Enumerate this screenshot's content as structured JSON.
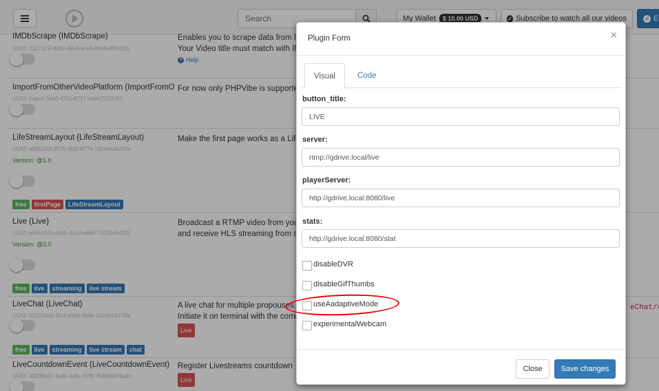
{
  "navbar": {
    "search_placeholder": "Search",
    "wallet_label": "My Wallet",
    "wallet_balance": "$ 10.00 USD",
    "subscribe_label": "Subscribe to watch all our videos",
    "right_button_label": "E"
  },
  "plugins": [
    {
      "title": "IMDbScrape (IMDbScrape)",
      "uuid": "UUID: 2117115f-dc62-49e3-ace9-86c6e8f9c815",
      "description_lines": [
        "Enables you to scrape data from IMD",
        "Your Video title must match with IMD"
      ],
      "help_label": "Help"
    },
    {
      "title": "ImportFromOtherVideoPlatform (ImportFromOtherVideoPlatform)",
      "uuid": "UUID: import-3440-472c-8717-video7332c82",
      "description_lines": [
        "For now only PHPVibe is supported"
      ]
    },
    {
      "title": "LifeStreamLayout (LifeStreamLayout)",
      "uuid": "UUID: a06522bf-3570-4b1f-877a-1d0e5cab205d",
      "version": "Version: @1.0",
      "description_lines": [
        "Make the first page works as a LifeS"
      ],
      "tags": [
        {
          "label": "free",
          "color": "#5cb85c"
        },
        {
          "label": "firstPage",
          "color": "#d9534f"
        },
        {
          "label": "LifeStreamLayout",
          "color": "#337ab7"
        }
      ]
    },
    {
      "title": "Live (Live)",
      "uuid": "UUID: e06b161c-cbd0-4c1d-a484-71018efa2f35",
      "version": "Version: @3.0",
      "description_lines": [
        "Broadcast a RTMP video from your",
        "and receive HLS streaming from se"
      ],
      "tags": [
        {
          "label": "free",
          "color": "#5cb85c"
        },
        {
          "label": "live",
          "color": "#337ab7"
        },
        {
          "label": "streaming",
          "color": "#337ab7"
        },
        {
          "label": "live stream",
          "color": "#337ab7"
        }
      ]
    },
    {
      "title": "LiveChat (LiveChat)",
      "uuid": "UUID: 52222da2-3f14-49db-958e-15ccb1407f0e",
      "description_lines": [
        "A live chat for multiple propouses",
        "Initiate it on terminal with the comma"
      ],
      "badge": "Live",
      "code_snippet": "eChat/cha",
      "tags": [
        {
          "label": "free",
          "color": "#5cb85c"
        },
        {
          "label": "live",
          "color": "#337ab7"
        },
        {
          "label": "streaming",
          "color": "#337ab7"
        },
        {
          "label": "live stream",
          "color": "#337ab7"
        },
        {
          "label": "chat",
          "color": "#337ab7"
        }
      ]
    },
    {
      "title": "LiveCountdownEvent (LiveCountdownEvent)",
      "uuid": "UUID: 43328e37-4adb-4cbc-8cf9-75d6ddd7babc",
      "description_lines": [
        "Register Livestreams countdown"
      ],
      "badge": "Live"
    }
  ],
  "modal": {
    "title": "Plugin Form",
    "close_symbol": "×",
    "tabs": [
      {
        "label": "Visual",
        "active": true
      },
      {
        "label": "Code",
        "active": false
      }
    ],
    "fields": [
      {
        "label": "button_title:",
        "value": "LIVE"
      },
      {
        "label": "server:",
        "value": "rtmp://gdrive.local/live"
      },
      {
        "label": "playerServer:",
        "value": "http://gdrive.local:8080/live"
      },
      {
        "label": "stats:",
        "value": "http://gdrive.local:8080/stat"
      }
    ],
    "checkboxes": [
      {
        "label": "disableDVR",
        "checked": false
      },
      {
        "label": "disableGifThumbs",
        "checked": false
      },
      {
        "label": "useAadaptiveMode",
        "checked": false,
        "highlighted": true
      },
      {
        "label": "experimentalWebcam",
        "checked": false
      }
    ],
    "footer": {
      "close_label": "Close",
      "save_label": "Save changes"
    }
  },
  "colors": {
    "primary": "#337ab7",
    "success": "#5cb85c",
    "danger": "#d9534f",
    "annotation": "#e00000"
  }
}
